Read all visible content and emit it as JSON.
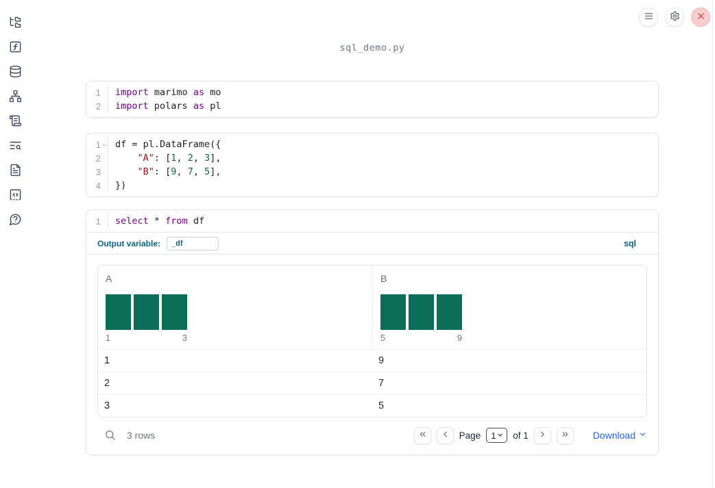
{
  "window": {
    "title": "sql_demo.py"
  },
  "sidebar": {
    "items": [
      {
        "icon": "file-explorer-icon"
      },
      {
        "icon": "variables-icon"
      },
      {
        "icon": "datasources-icon"
      },
      {
        "icon": "dependencies-icon"
      },
      {
        "icon": "scratchpad-icon"
      },
      {
        "icon": "logs-icon"
      },
      {
        "icon": "documentation-icon"
      },
      {
        "icon": "snippets-icon"
      },
      {
        "icon": "help-icon"
      }
    ]
  },
  "header": {
    "buttons": [
      {
        "icon": "menu-icon"
      },
      {
        "icon": "settings-icon"
      },
      {
        "icon": "close-icon"
      }
    ]
  },
  "colors": {
    "keyword": "#770088",
    "string": "#aa1111",
    "number": "#116644",
    "histogram_bar": "#0c6d59",
    "accent_blue": "#10607f",
    "link_blue": "#2563eb",
    "close_red": "#d25050"
  },
  "cells": {
    "imports": {
      "lines": [
        {
          "num": "1",
          "tokens": [
            {
              "t": "import"
            },
            {
              "t": " marimo "
            },
            {
              "t": "as"
            },
            {
              "t": " mo"
            }
          ]
        },
        {
          "num": "2",
          "tokens": [
            {
              "t": "import"
            },
            {
              "t": " polars "
            },
            {
              "t": "as"
            },
            {
              "t": " pl"
            }
          ]
        }
      ]
    },
    "dataframe": {
      "lines": [
        {
          "num": "1",
          "tokens": [
            {
              "t": "df = pl.DataFrame({"
            }
          ]
        },
        {
          "num": "2",
          "tokens": [
            {
              "t": "    "
            },
            {
              "t": "\"A\""
            },
            {
              "t": ": ["
            },
            {
              "t": "1"
            },
            {
              "t": ", "
            },
            {
              "t": "2"
            },
            {
              "t": ", "
            },
            {
              "t": "3"
            },
            {
              "t": "],"
            }
          ]
        },
        {
          "num": "3",
          "tokens": [
            {
              "t": "    "
            },
            {
              "t": "\"B\""
            },
            {
              "t": ": ["
            },
            {
              "t": "9"
            },
            {
              "t": ", "
            },
            {
              "t": "7"
            },
            {
              "t": ", "
            },
            {
              "t": "5"
            },
            {
              "t": "],"
            }
          ]
        },
        {
          "num": "4",
          "tokens": [
            {
              "t": "})"
            }
          ]
        }
      ]
    },
    "sql": {
      "lines": [
        {
          "num": "1",
          "tokens": [
            {
              "t": "select"
            },
            {
              "t": " * "
            },
            {
              "t": "from"
            },
            {
              "t": " df"
            }
          ]
        }
      ],
      "meta": {
        "output_variable_label": "Output variable:",
        "output_variable_value": "_df",
        "language": "sql"
      }
    }
  },
  "table": {
    "columns": [
      {
        "name": "A",
        "hist_min": "1",
        "hist_max": "3",
        "bar_heights": [
          1,
          1,
          1
        ]
      },
      {
        "name": "B",
        "hist_min": "5",
        "hist_max": "9",
        "bar_heights": [
          1,
          1,
          1
        ]
      }
    ],
    "rows": [
      {
        "a": "1",
        "b": "9"
      },
      {
        "a": "2",
        "b": "7"
      },
      {
        "a": "3",
        "b": "5"
      }
    ],
    "footer": {
      "row_count": "3 rows",
      "page_label": "Page",
      "page_value": "1",
      "of_label": "of 1",
      "download_label": "Download"
    }
  }
}
